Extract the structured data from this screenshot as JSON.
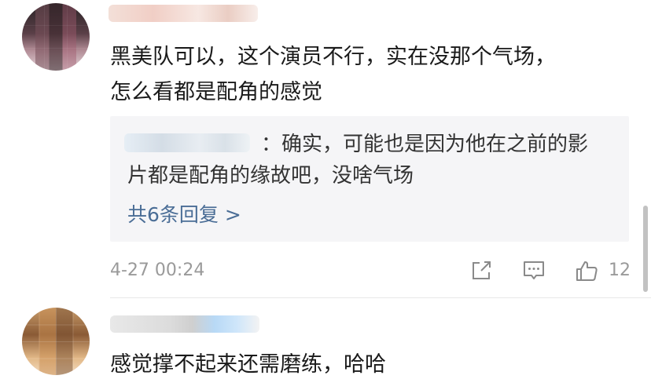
{
  "comments": [
    {
      "text_line1": "黑美队可以，这个演员不行，实在没那个气场，",
      "text_line2": "怎么看都是配角的感觉",
      "reply": {
        "text_line1": "：确实，可能也是因为他在之前的影",
        "text_line2": "片都是配角的缘故吧，没啥气场",
        "more_label": "共6条回复 >"
      },
      "timestamp": "4-27 00:24",
      "like_count": "12"
    },
    {
      "text": "感觉撑不起来还需磨练，哈哈"
    }
  ],
  "icons": {
    "share": "share-icon",
    "comment": "comment-icon",
    "like": "thumbs-up-icon"
  },
  "colors": {
    "link": "#4a6d96",
    "meta_text": "#9a9a9a",
    "reply_bg": "#f5f5f7"
  }
}
